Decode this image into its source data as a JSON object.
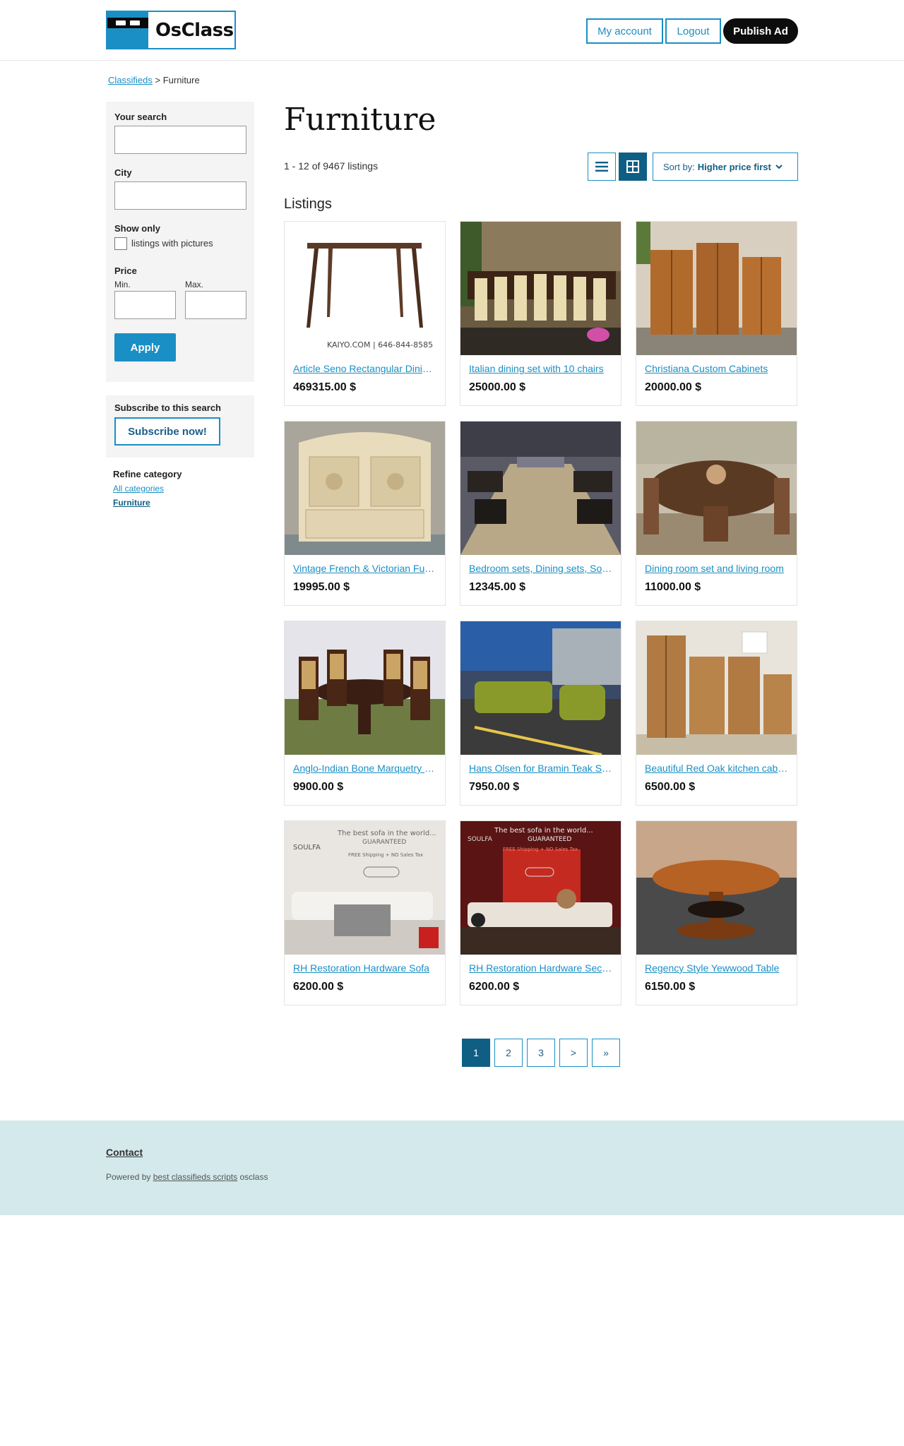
{
  "header": {
    "logo_text": "OsClass",
    "my_account": "My account",
    "logout": "Logout",
    "publish": "Publish Ad"
  },
  "breadcrumb": {
    "root": "Classifieds",
    "separator": ">",
    "current": "Furniture"
  },
  "sidebar": {
    "search_label": "Your search",
    "city_label": "City",
    "show_only_label": "Show only",
    "pictures_label": "listings with pictures",
    "price_label": "Price",
    "min_label": "Min.",
    "max_label": "Max.",
    "apply": "Apply",
    "subscribe_title": "Subscribe to this search",
    "subscribe_btn": "Subscribe now!",
    "refine_title": "Refine category",
    "all_categories": "All categories",
    "current_category": "Furniture"
  },
  "main": {
    "title": "Furniture",
    "count": "1 - 12 of 9467 listings",
    "sort_prefix": "Sort by:",
    "sort_value": "Higher price first",
    "listings_title": "Listings"
  },
  "listings": [
    {
      "title": "Article Seno Rectangular Dining Table",
      "price": "469315.00 $"
    },
    {
      "title": "Italian dining set with 10 chairs",
      "price": "25000.00 $"
    },
    {
      "title": "Christiana Custom Cabinets",
      "price": "20000.00 $"
    },
    {
      "title": "Vintage French & Victorian Furniture",
      "price": "19995.00 $"
    },
    {
      "title": "Bedroom sets, Dining sets, Sofas",
      "price": "12345.00 $"
    },
    {
      "title": "Dining room set and living room",
      "price": "11000.00 $"
    },
    {
      "title": "Anglo-Indian Bone Marquetry Set",
      "price": "9900.00 $"
    },
    {
      "title": "Hans Olsen for Bramin Teak Sofa",
      "price": "7950.00 $"
    },
    {
      "title": "Beautiful Red Oak kitchen cabinets",
      "price": "6500.00 $"
    },
    {
      "title": "RH Restoration Hardware Sofa",
      "price": "6200.00 $"
    },
    {
      "title": "RH Restoration Hardware Sectional",
      "price": "6200.00 $"
    },
    {
      "title": "Regency Style Yewwood Table",
      "price": "6150.00 $"
    }
  ],
  "pagination": {
    "p1": "1",
    "p2": "2",
    "p3": "3",
    "next": ">",
    "last": "»"
  },
  "footer": {
    "contact": "Contact",
    "powered_prefix": "Powered by",
    "powered_link": "best classifieds scripts",
    "powered_suffix": "osclass"
  },
  "colors": {
    "accent": "#1a8fc5",
    "accent_dark": "#0f5f85",
    "footer_bg": "#d3e9eb",
    "sidebar_bg": "#f4f4f4"
  }
}
